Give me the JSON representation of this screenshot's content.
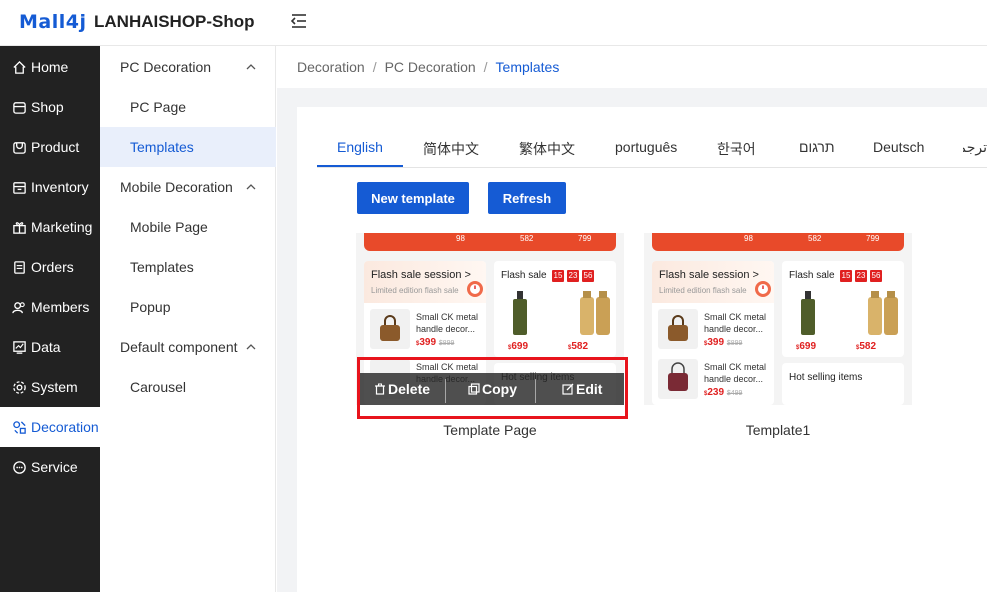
{
  "header": {
    "logo": "Mall4j",
    "shop_name": "LANHAISHOP-Shop"
  },
  "main_menu": [
    {
      "label": "Home",
      "icon": "home-icon"
    },
    {
      "label": "Shop",
      "icon": "shop-icon"
    },
    {
      "label": "Product",
      "icon": "product-icon"
    },
    {
      "label": "Inventory",
      "icon": "inventory-icon"
    },
    {
      "label": "Marketing",
      "icon": "gift-icon"
    },
    {
      "label": "Orders",
      "icon": "orders-icon"
    },
    {
      "label": "Members",
      "icon": "members-icon"
    },
    {
      "label": "Data",
      "icon": "chart-icon"
    },
    {
      "label": "System",
      "icon": "gear-icon"
    },
    {
      "label": "Decoration",
      "icon": "decoration-icon",
      "active": true
    },
    {
      "label": "Service",
      "icon": "chat-icon"
    }
  ],
  "sub_menu": {
    "pc_group": "PC Decoration",
    "pc_page": "PC Page",
    "pc_templates": "Templates",
    "mobile_group": "Mobile Decoration",
    "mobile_page": "Mobile Page",
    "mobile_templates": "Templates",
    "popup": "Popup",
    "default_group": "Default component",
    "carousel": "Carousel"
  },
  "breadcrumb": [
    "Decoration",
    "PC Decoration",
    "Templates"
  ],
  "tabs": [
    "English",
    "简体中文",
    "繁体中文",
    "português",
    "한국어",
    "תרגום",
    "Deutsch",
    "ترجمة"
  ],
  "buttons": {
    "new_template": "New template",
    "refresh": "Refresh"
  },
  "templates": [
    {
      "name": "Template Page"
    },
    {
      "name": "Template1"
    }
  ],
  "thumbnail": {
    "top_prices": [
      "98",
      "582",
      "799"
    ],
    "flash_session": "Flash sale session >",
    "limited": "Limited edition flash sale",
    "flash_sale": "Flash sale",
    "timer": [
      "15",
      "23",
      "56"
    ],
    "product_name": "Small CK metal handle decor...",
    "price_1": "399",
    "old_price_1": "$899",
    "price_2": "239",
    "old_price_2": "$499",
    "price_a": "699",
    "price_b": "582",
    "hot_selling": "Hot selling items",
    "currency": "$"
  },
  "overlay": {
    "delete": "Delete",
    "copy": "Copy",
    "edit": "Edit"
  },
  "colors": {
    "accent": "#155bd4",
    "sidebar": "#222222",
    "highlight": "#e8141c"
  }
}
